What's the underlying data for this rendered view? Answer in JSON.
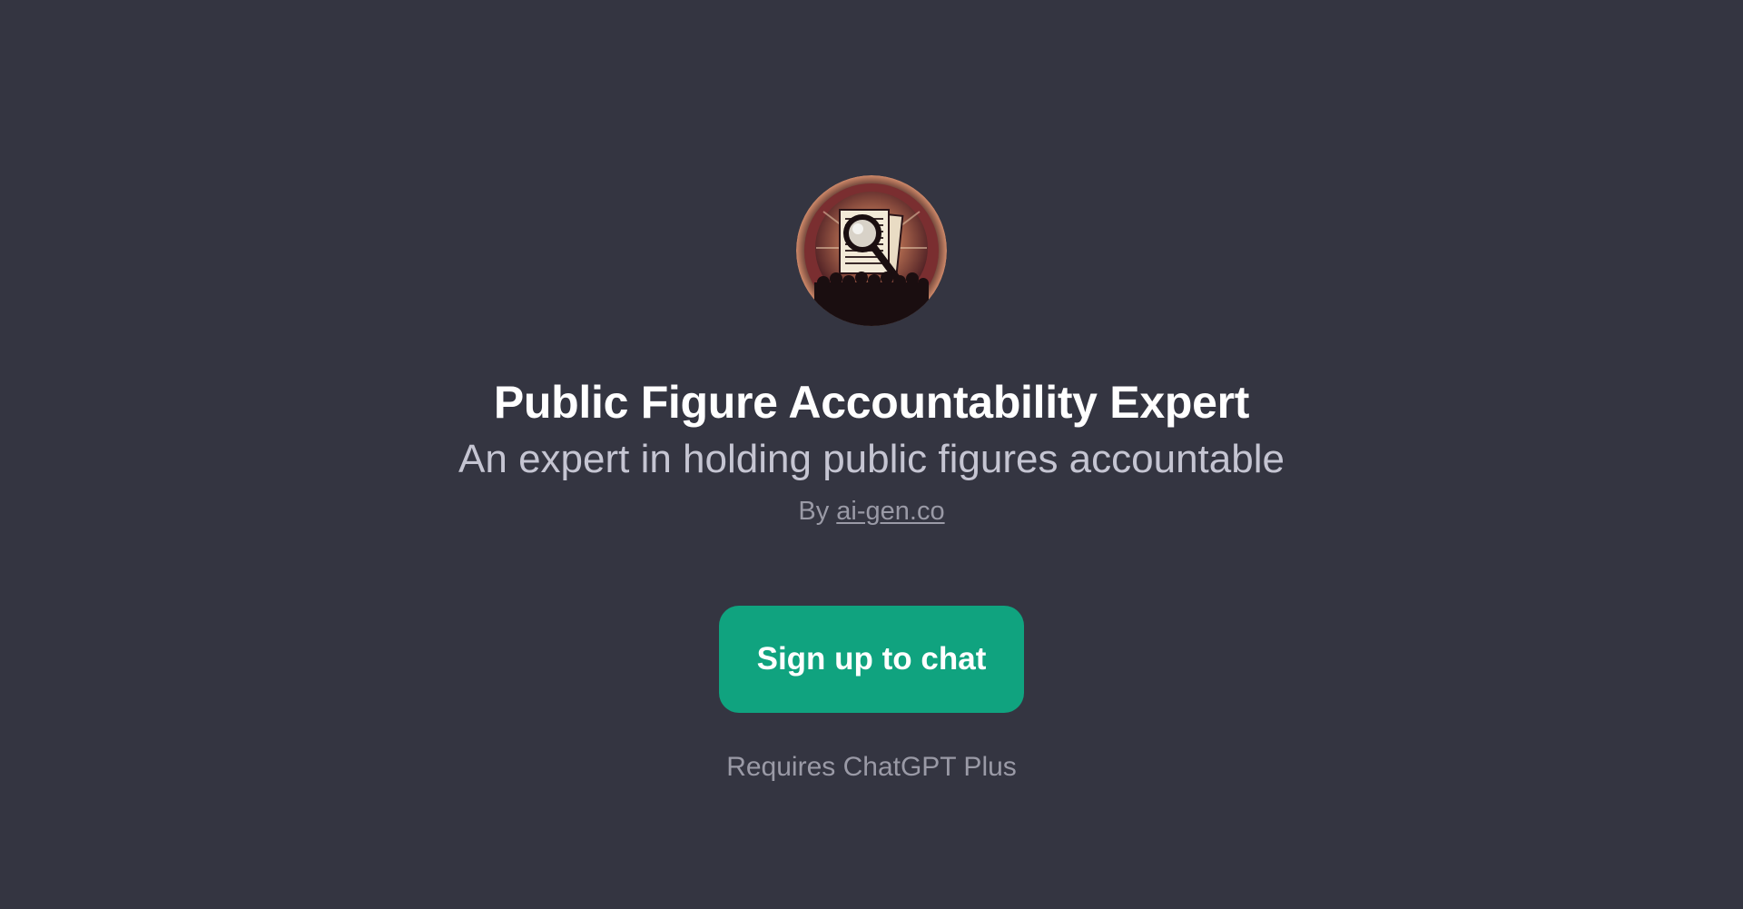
{
  "gpt": {
    "name": "Public Figure Accountability Expert",
    "description": "An expert in holding public figures accountable",
    "author_prefix": "By",
    "author_link": "ai-gen.co",
    "avatar_icon": "magnifying-glass-over-documents-icon"
  },
  "actions": {
    "signup_label": "Sign up to chat",
    "requirement_note": "Requires ChatGPT Plus"
  },
  "colors": {
    "background": "#343541",
    "accent": "#10a37f",
    "title": "#ffffff",
    "subtitle": "#c5c5d2",
    "muted": "#9a9aa6"
  }
}
